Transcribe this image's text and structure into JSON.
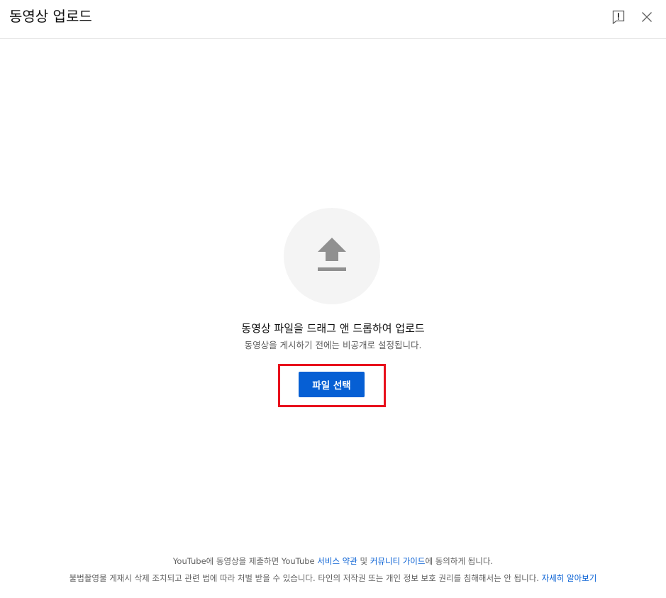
{
  "header": {
    "title": "동영상 업로드",
    "feedback_icon": "feedback-icon",
    "close_icon": "close-icon"
  },
  "main": {
    "upload_icon": "upload-arrow-icon",
    "drag_text": "동영상 파일을 드래그 앤 드롭하여 업로드",
    "private_text": "동영상을 게시하기 전에는 비공개로 설정됩니다.",
    "select_button_label": "파일 선택"
  },
  "footer": {
    "line1_part1": "YouTube에 동영상을 제출하면 YouTube ",
    "terms_link": "서비스 약관",
    "line1_part2": " 및 ",
    "guidelines_link": "커뮤니티 가이드",
    "line1_part3": "에 동의하게 됩니다.",
    "line2_text": "불법촬영물 게재시 삭제 조치되고 관련 법에 따라 처벌 받을 수 있습니다. 타인의 저작권 또는 개인 정보 보호 권리를 침해해서는 안 됩니다. ",
    "learn_more_link": "자세히 알아보기"
  },
  "colors": {
    "accent": "#065fd4",
    "highlight": "#e8101c",
    "circle_bg": "#f4f4f4",
    "icon_gray": "#909090"
  }
}
